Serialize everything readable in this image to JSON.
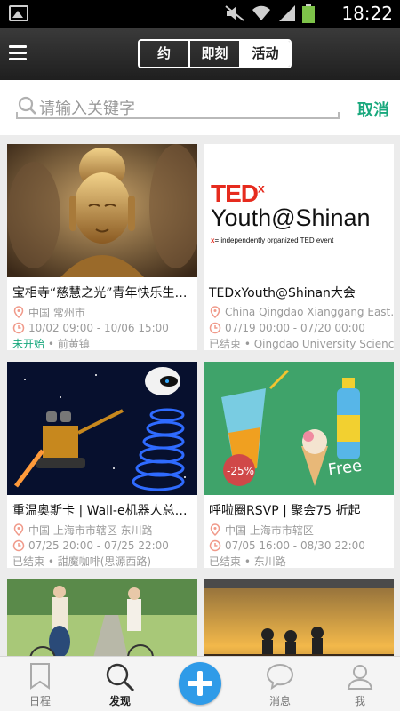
{
  "status_bar": {
    "time": "18:22"
  },
  "header": {
    "segments": [
      "约",
      "即刻",
      "活动"
    ],
    "active_segment": "活动"
  },
  "search": {
    "placeholder": "请输入关键字",
    "cancel_label": "取消"
  },
  "cards": [
    {
      "title": "宝相寺“慈慧之光”青年快乐生…",
      "location": "中国 常州市",
      "time": "10/02 09:00 - 10/06 15:00",
      "status": "未开始",
      "venue": "前黄镇",
      "image": "buddha-statue"
    },
    {
      "title": "TEDxYouth@Shinan大会",
      "location": "China Qingdao Xianggang East…",
      "time": "07/19 00:00 - 07/20 00:00",
      "status": "已结束",
      "venue": "Qingdao University Science",
      "image": "tedx-logo",
      "image_text": {
        "brand": "TED",
        "x": "x",
        "event": "Youth@Shinan",
        "tagline": "= independently organized TED event"
      }
    },
    {
      "title": "重温奥斯卡 | Wall-e机器人总…",
      "location": "中国 上海市市辖区 东川路",
      "time": "07/25 20:00 - 07/25 22:00",
      "status": "已结束",
      "venue": "甜魔咖啡(思源西路)",
      "image": "wall-e-eve-space"
    },
    {
      "title": "呼啦圈RSVP | 聚会75 折起",
      "location": "中国 上海市市辖区",
      "time": "07/05 16:00 - 08/30 22:00",
      "status": "已结束",
      "venue": "东川路",
      "image": "drinks-icecream",
      "image_text": {
        "discount": "-25%",
        "free": "Free"
      }
    },
    {
      "image": "cycling-girls"
    },
    {
      "image": "hikers-sunset"
    }
  ],
  "tabbar": {
    "tabs": [
      {
        "label": "日程",
        "icon": "bookmark-icon"
      },
      {
        "label": "发现",
        "icon": "search-icon"
      },
      {
        "label": "消息",
        "icon": "chat-bubble-icon"
      },
      {
        "label": "我",
        "icon": "user-icon"
      }
    ],
    "active_tab": "发现",
    "center_button": "plus-icon"
  },
  "colors": {
    "accent_green": "#19a87d",
    "accent_blue": "#2f9be8",
    "header_bg": "#2a2a2a",
    "ted_red": "#e62b1e"
  }
}
